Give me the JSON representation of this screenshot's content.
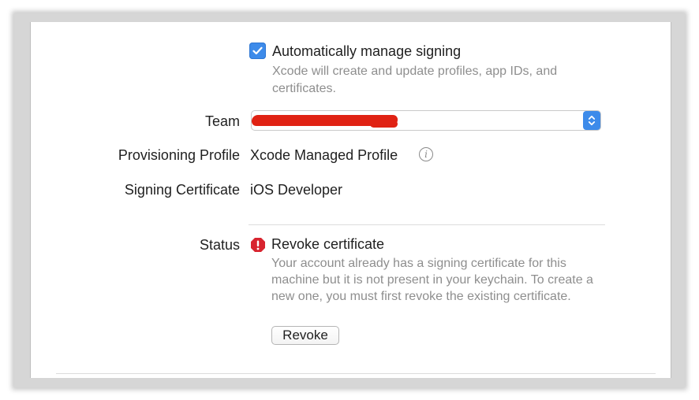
{
  "signing": {
    "auto_manage": {
      "checked": true,
      "label": "Automatically manage signing",
      "description": "Xcode will create and update profiles, app IDs, and certificates."
    },
    "team": {
      "label": "Team",
      "value": ""
    },
    "provisioning_profile": {
      "label": "Provisioning Profile",
      "value": "Xcode Managed Profile",
      "info_icon": "info-icon"
    },
    "signing_certificate": {
      "label": "Signing Certificate",
      "value": "iOS Developer"
    },
    "status": {
      "label": "Status",
      "title": "Revoke certificate",
      "description": "Your account already has a signing certificate for this machine but it is not present in your keychain. To create a new one, you must first revoke the existing certificate.",
      "icon": "error-icon",
      "revoke_button_label": "Revoke"
    }
  },
  "colors": {
    "accent": "#3d8bea",
    "error": "#d8242f",
    "redaction": "#e02213",
    "secondary_text": "#8e8e8e"
  }
}
